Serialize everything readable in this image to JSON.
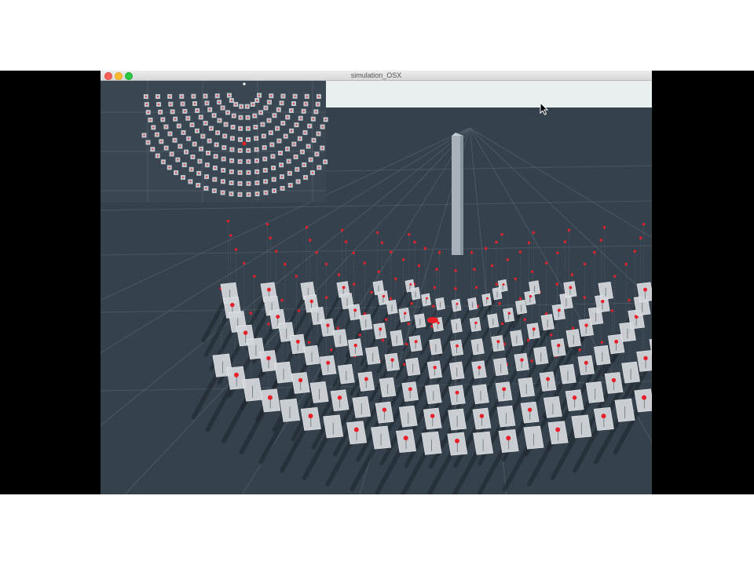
{
  "window": {
    "title": "simulation_OSX"
  },
  "scene": {
    "description_icons": [
      "heliostat-field",
      "receiver-tower",
      "minimap-view",
      "mouse-cursor-icon"
    ],
    "colors": {
      "ground": "#35414c",
      "grid": "#56636f",
      "mirror": "#d2d6da",
      "target": "#e8202a",
      "tower": "#a7b1ba",
      "sky": "#e9eef0"
    }
  }
}
